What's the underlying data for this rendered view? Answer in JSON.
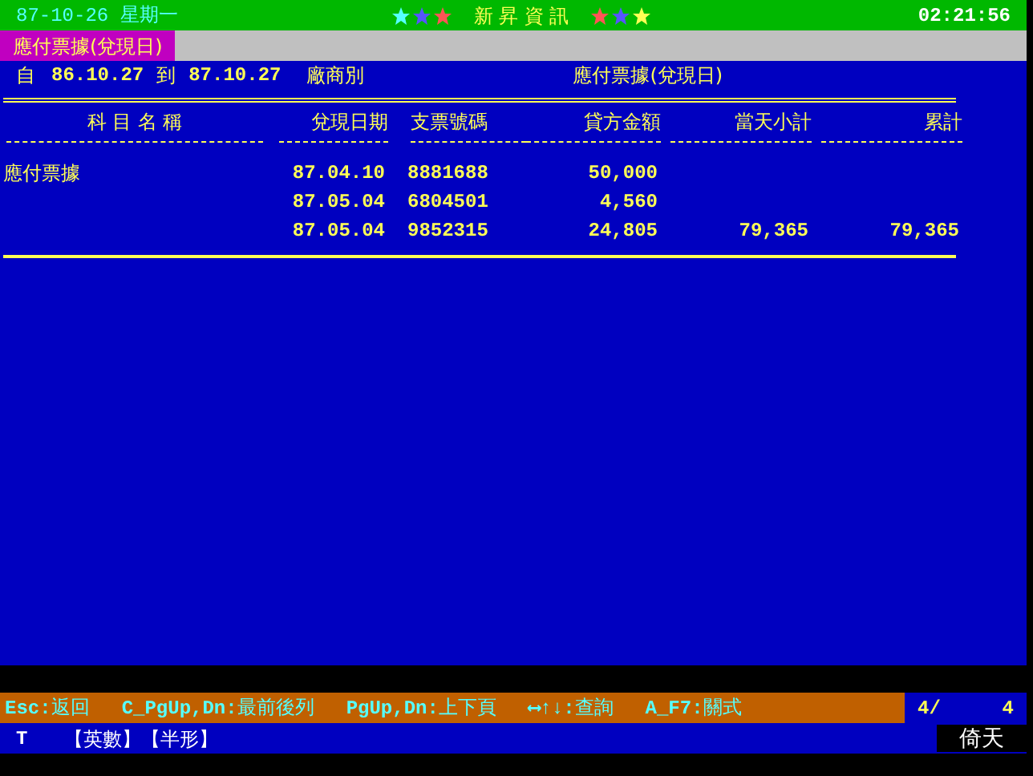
{
  "title_bar": {
    "date": "87-10-26 星期一",
    "app_name": "新 昇 資 訊",
    "time": "02:21:56"
  },
  "report_tab": {
    "label": "應付票據(兌現日)"
  },
  "criteria": {
    "from_label": "自",
    "from": "86.10.27",
    "to_label": "到",
    "to": "87.10.27",
    "group": "廠商別",
    "report": "應付票據(兌現日)"
  },
  "table": {
    "columns": [
      "科 目 名 稱",
      "兌現日期",
      "支票號碼",
      "貸方金額",
      "當天小計",
      "累計"
    ],
    "rows": [
      {
        "cells": [
          "應付票據",
          "87.04.10",
          "8881688",
          "50,000",
          "",
          ""
        ]
      },
      {
        "cells": [
          "",
          "87.05.04",
          "6804501",
          "4,560",
          "",
          ""
        ]
      },
      {
        "cells": [
          "",
          "87.05.04",
          "9852315",
          "24,805",
          "79,365",
          "79,365"
        ]
      }
    ]
  },
  "status_bar": {
    "keys": [
      {
        "key": "Esc:",
        "action": "返回"
      },
      {
        "key": "C_PgUp,Dn:",
        "action": "最前後列"
      },
      {
        "key": "PgUp,Dn:",
        "action": "上下頁"
      },
      {
        "key": "⟷↑↓:",
        "action": "查詢"
      },
      {
        "key": "A_F7:",
        "action": "關式"
      }
    ],
    "page": "4/",
    "pages": "4"
  },
  "input_line": {
    "mode": "T",
    "modes": "【英數】【半形】",
    "ime": "倚天"
  }
}
